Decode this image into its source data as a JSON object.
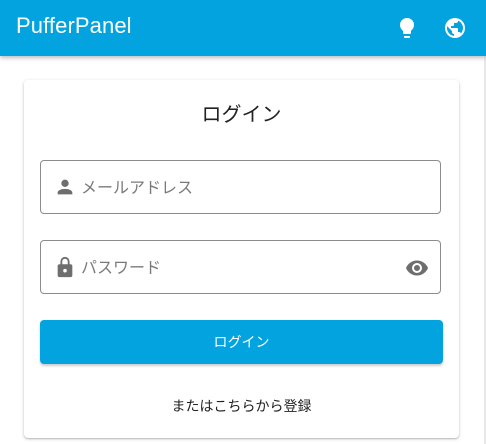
{
  "app_bar": {
    "title": "PufferPanel",
    "background": "#03a3e0",
    "icons": [
      "lightbulb-icon",
      "globe-icon"
    ]
  },
  "login_card": {
    "title": "ログイン",
    "email_field": {
      "placeholder": "メールアドレス",
      "value": "",
      "icon": "account-icon"
    },
    "password_field": {
      "placeholder": "パスワード",
      "value": "",
      "icon": "lock-icon",
      "toggle_icon": "eye-icon"
    },
    "login_button_label": "ログイン",
    "register_link_label": "またはこちらから登録"
  }
}
